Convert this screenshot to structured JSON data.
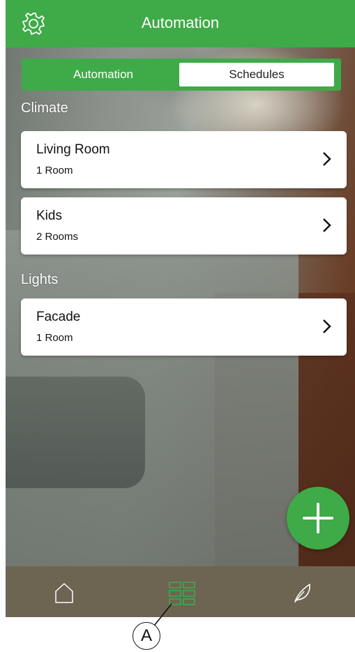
{
  "header": {
    "title": "Automation",
    "settings_icon": "gear-icon"
  },
  "segmented": {
    "tabs": [
      {
        "label": "Automation",
        "selected": true
      },
      {
        "label": "Schedules",
        "selected": false
      }
    ]
  },
  "sections": [
    {
      "title": "Climate",
      "items": [
        {
          "name": "Living Room",
          "sub": "1 Room"
        },
        {
          "name": "Kids",
          "sub": "2 Rooms"
        }
      ]
    },
    {
      "title": "Lights",
      "items": [
        {
          "name": "Facade",
          "sub": "1 Room"
        }
      ]
    }
  ],
  "fab": {
    "icon": "plus-icon"
  },
  "tabbar": {
    "items": [
      {
        "icon": "home-icon"
      },
      {
        "icon": "grid-icon",
        "active": true
      },
      {
        "icon": "leaf-icon"
      }
    ]
  },
  "callout": {
    "label": "A"
  },
  "colors": {
    "accent": "#3faa48",
    "tabbar": "#6d6552"
  }
}
